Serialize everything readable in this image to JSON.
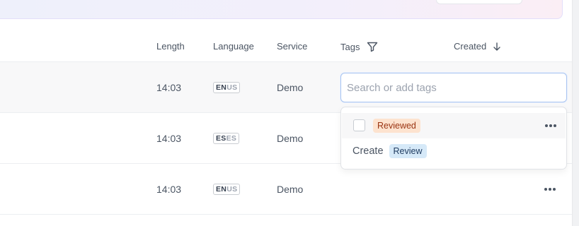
{
  "columns": {
    "length": "Length",
    "language": "Language",
    "service": "Service",
    "tags": "Tags",
    "created": "Created"
  },
  "rows": [
    {
      "length": "14:03",
      "lang_primary": "EN",
      "lang_region": "US",
      "service": "Demo"
    },
    {
      "length": "14:03",
      "lang_primary": "ES",
      "lang_region": "ES",
      "service": "Demo"
    },
    {
      "length": "14:03",
      "lang_primary": "EN",
      "lang_region": "US",
      "service": "Demo"
    }
  ],
  "tag_editor": {
    "placeholder": "Search or add tags",
    "value": "",
    "existing_tag": "Reviewed",
    "existing_tag_checked": false,
    "create_label": "Create",
    "new_tag": "Review"
  },
  "colors": {
    "reviewed_tag_bg": "#fde3cf",
    "review_tag_bg": "#d6e9f8",
    "input_focus_border": "#a9c4f0"
  }
}
